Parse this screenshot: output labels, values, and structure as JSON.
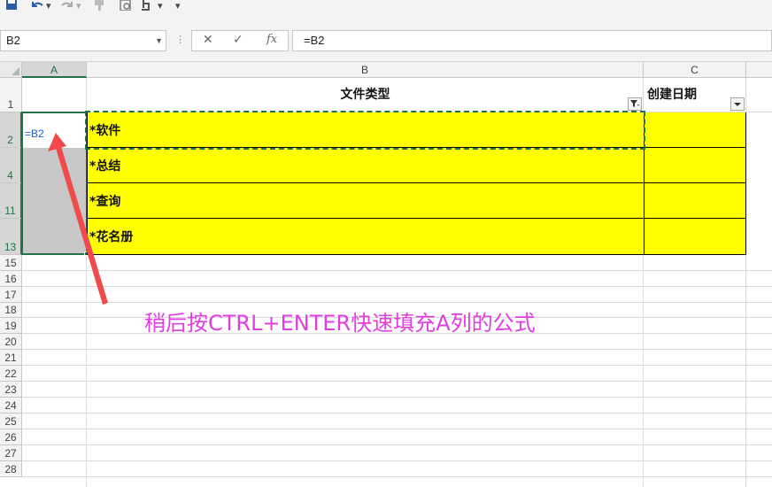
{
  "name_box": {
    "value": "B2"
  },
  "formula_bar": {
    "value": "=B2",
    "cancel_symbol": "✕",
    "enter_symbol": "✓",
    "fx_symbol": "fx"
  },
  "columns": [
    "A",
    "B",
    "C"
  ],
  "rows": [
    "1",
    "2",
    "4",
    "11",
    "13",
    "15",
    "16",
    "17",
    "18",
    "19",
    "20",
    "21",
    "22",
    "23",
    "24",
    "25",
    "26",
    "27",
    "28"
  ],
  "header_row": {
    "b": "文件类型",
    "c": "创建日期"
  },
  "data_rows": [
    {
      "b": "*软件"
    },
    {
      "b": "*总结"
    },
    {
      "b": "*查询"
    },
    {
      "b": "*花名册"
    }
  ],
  "active_cell_formula": "=B2",
  "annotation": "稍后按CTRL+ENTER快速填充A列的公式",
  "colors": {
    "accent": "#217346",
    "yellow_fill": "#ffff00",
    "annotation": "#e03ee0",
    "arrow": "#f04a4a",
    "formula_text": "#1f5fc2"
  }
}
